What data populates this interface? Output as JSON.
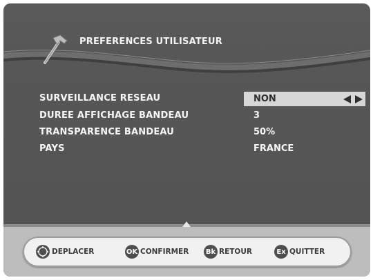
{
  "header": {
    "title": "PREFERENCES UTILISATEUR"
  },
  "menu": {
    "rows": [
      {
        "label": "SURVEILLANCE RESEAU",
        "value": "NON"
      },
      {
        "label": "DUREE AFFICHAGE BANDEAU",
        "value": "3"
      },
      {
        "label": "TRANSPARENCE BANDEAU",
        "value": "50%"
      },
      {
        "label": "PAYS",
        "value": "FRANCE"
      }
    ]
  },
  "footer": {
    "buttons": [
      {
        "key": "",
        "icon": "dpad-icon",
        "label": "DEPLACER"
      },
      {
        "key": "OK",
        "icon": "ok-key-icon",
        "label": "CONFIRMER"
      },
      {
        "key": "Bk",
        "icon": "back-key-icon",
        "label": "RETOUR"
      },
      {
        "key": "Ex",
        "icon": "exit-key-icon",
        "label": "QUITTER"
      }
    ]
  },
  "icons": {
    "header": "hammer-icon",
    "selector": "left-right-arrows-icon"
  },
  "colors": {
    "background": "#555555",
    "text": "#f6f6f6",
    "highlight": "#d7d7d7",
    "footer": "#bdbdbd"
  }
}
